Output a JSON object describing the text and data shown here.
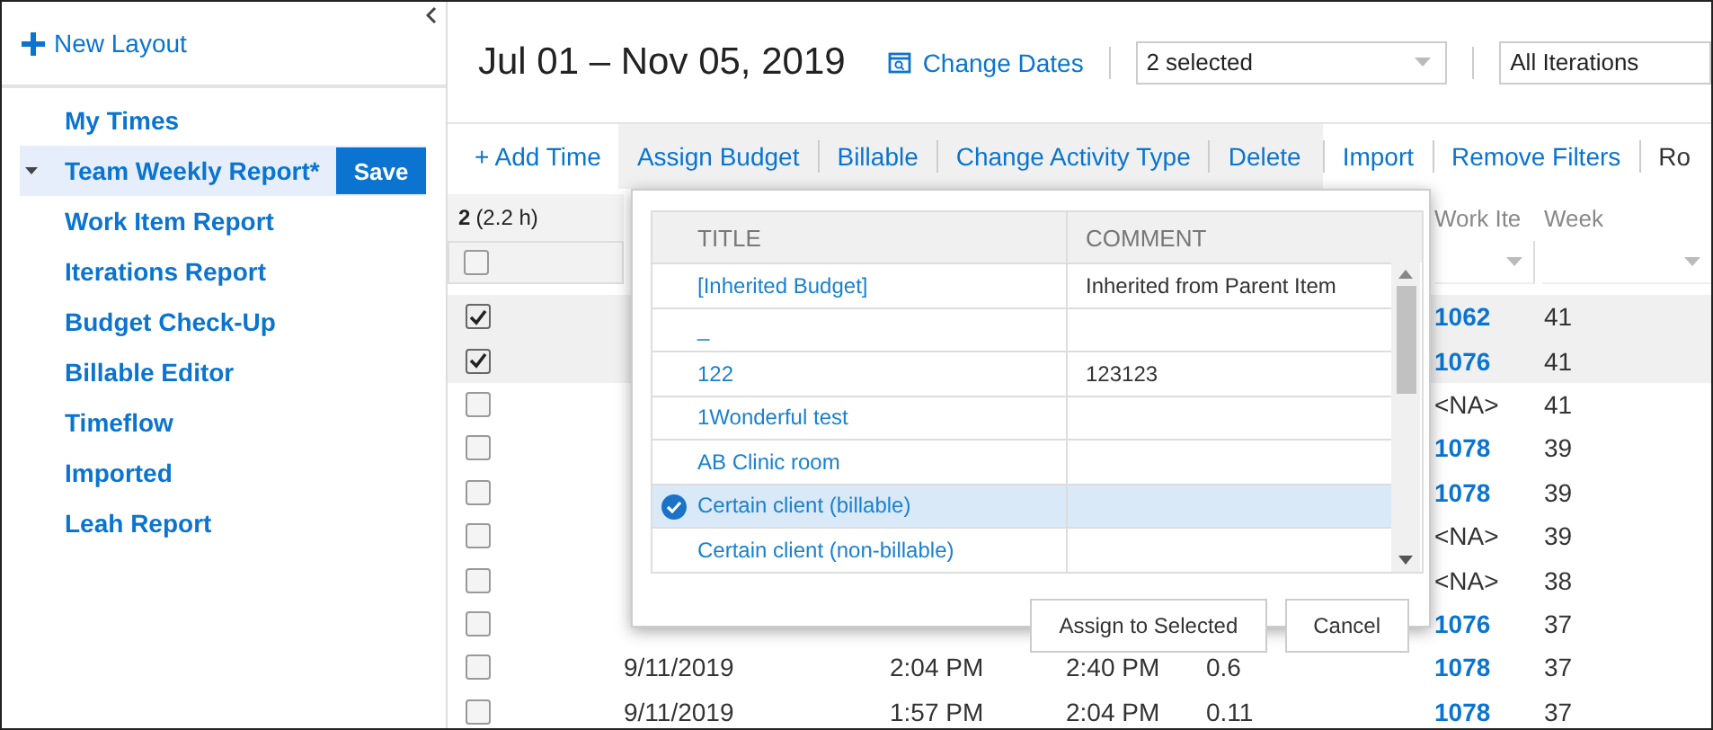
{
  "sidebar": {
    "new_layout": "New Layout",
    "items": [
      {
        "label": "My Times",
        "selected": false
      },
      {
        "label": "Team Weekly Report*",
        "selected": true,
        "expanded": true,
        "action": "Save"
      },
      {
        "label": "Work Item Report",
        "selected": false
      },
      {
        "label": "Iterations Report",
        "selected": false
      },
      {
        "label": "Budget Check-Up",
        "selected": false
      },
      {
        "label": "Billable Editor",
        "selected": false
      },
      {
        "label": "Timeflow",
        "selected": false
      },
      {
        "label": "Imported",
        "selected": false
      },
      {
        "label": "Leah Report",
        "selected": false
      }
    ]
  },
  "header": {
    "title": "Jul 01 – Nov 05, 2019",
    "change_dates": "Change Dates",
    "team_filter": "2 selected",
    "iteration_filter": "All Iterations"
  },
  "toolbar": {
    "add": "+ Add Time",
    "group": [
      "Assign Budget",
      "Billable",
      "Change Activity Type",
      "Delete"
    ],
    "more": [
      "Import",
      "Remove Filters",
      "Ro"
    ]
  },
  "grid": {
    "summary_count": "2",
    "summary_hours": "(2.2 h)",
    "columns": [
      "Work Ite",
      "Week"
    ],
    "all_checked": false,
    "rows": [
      {
        "checked": true,
        "work_item": "1062",
        "linked": true,
        "week": "41"
      },
      {
        "checked": true,
        "work_item": "1076",
        "linked": true,
        "week": "41"
      },
      {
        "checked": false,
        "work_item": "<NA>",
        "linked": false,
        "week": "41"
      },
      {
        "checked": false,
        "work_item": "1078",
        "linked": true,
        "week": "39"
      },
      {
        "checked": false,
        "work_item": "1078",
        "linked": true,
        "week": "39"
      },
      {
        "checked": false,
        "work_item": "<NA>",
        "linked": false,
        "week": "39"
      },
      {
        "checked": false,
        "work_item": "<NA>",
        "linked": false,
        "week": "38"
      },
      {
        "checked": false,
        "work_item": "1076",
        "linked": true,
        "week": "37"
      },
      {
        "checked": false,
        "date": "9/11/2019",
        "start": "2:04 PM",
        "end": "2:40 PM",
        "duration": "0.6",
        "work_item": "1078",
        "linked": true,
        "week": "37"
      },
      {
        "checked": false,
        "date": "9/11/2019",
        "start": "1:57 PM",
        "end": "2:04 PM",
        "duration": "0.11",
        "work_item": "1078",
        "linked": true,
        "week": "37"
      }
    ]
  },
  "dialog": {
    "columns": [
      "TITLE",
      "COMMENT"
    ],
    "rows": [
      {
        "title": "[Inherited Budget]",
        "comment": "Inherited from Parent Item",
        "selected": false
      },
      {
        "title": "_",
        "selected": false
      },
      {
        "title": "122",
        "comment": "123123",
        "selected": false
      },
      {
        "title": "1Wonderful test",
        "selected": false
      },
      {
        "title": "AB Clinic room",
        "selected": false
      },
      {
        "title": "Certain client (billable)",
        "selected": true
      },
      {
        "title": "Certain client (non-billable)",
        "selected": false
      }
    ],
    "buttons": [
      "Assign to Selected",
      "Cancel"
    ]
  }
}
